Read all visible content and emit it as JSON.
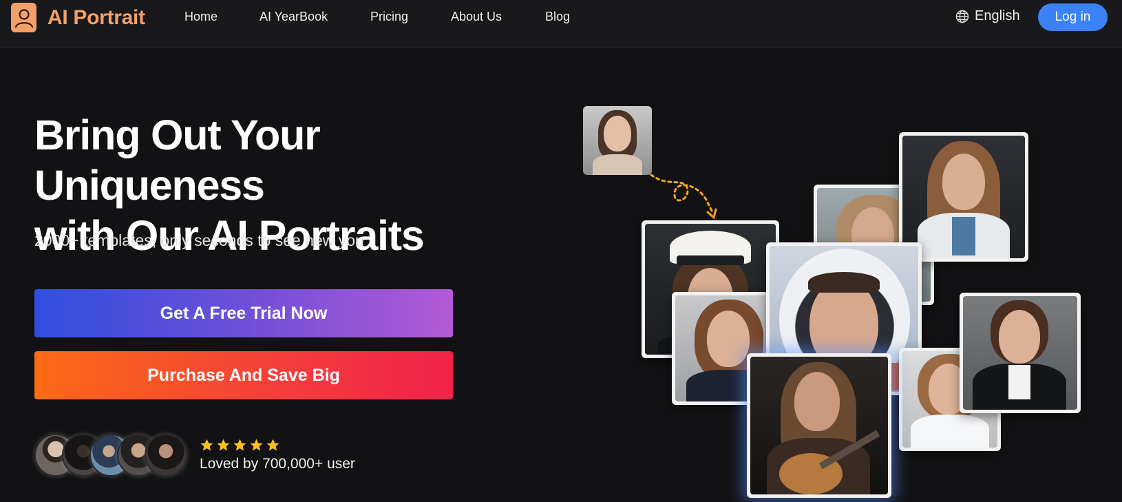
{
  "brand": {
    "name": "AI Portrait",
    "accent": "#f4a06a",
    "icon": "user-icon"
  },
  "nav": {
    "links": [
      {
        "label": "Home"
      },
      {
        "label": "AI YearBook"
      },
      {
        "label": "Pricing"
      },
      {
        "label": "About Us"
      },
      {
        "label": "Blog"
      }
    ],
    "language": {
      "label": "English",
      "icon": "globe-icon"
    },
    "login": {
      "label": "Log in",
      "color": "#3b82f6"
    }
  },
  "hero": {
    "title_line1": "Bring Out Your Uniqueness",
    "title_line2": "with Our AI Portraits",
    "subtitle": "2000+ templates, only seconds to see new you",
    "cta_primary": "Get A Free Trial Now",
    "cta_secondary": "Purchase And Save Big"
  },
  "social_proof": {
    "rating": 5,
    "text": "Loved by 700,000+ user"
  },
  "collage": {
    "photos": [
      {
        "name": "source-photo"
      },
      {
        "name": "navy-officer-portrait"
      },
      {
        "name": "windswept-portrait"
      },
      {
        "name": "doctor-portrait"
      },
      {
        "name": "police-portrait"
      },
      {
        "name": "astronaut-portrait"
      },
      {
        "name": "guitarist-portrait"
      },
      {
        "name": "scientist-portrait"
      },
      {
        "name": "business-portrait"
      }
    ]
  }
}
